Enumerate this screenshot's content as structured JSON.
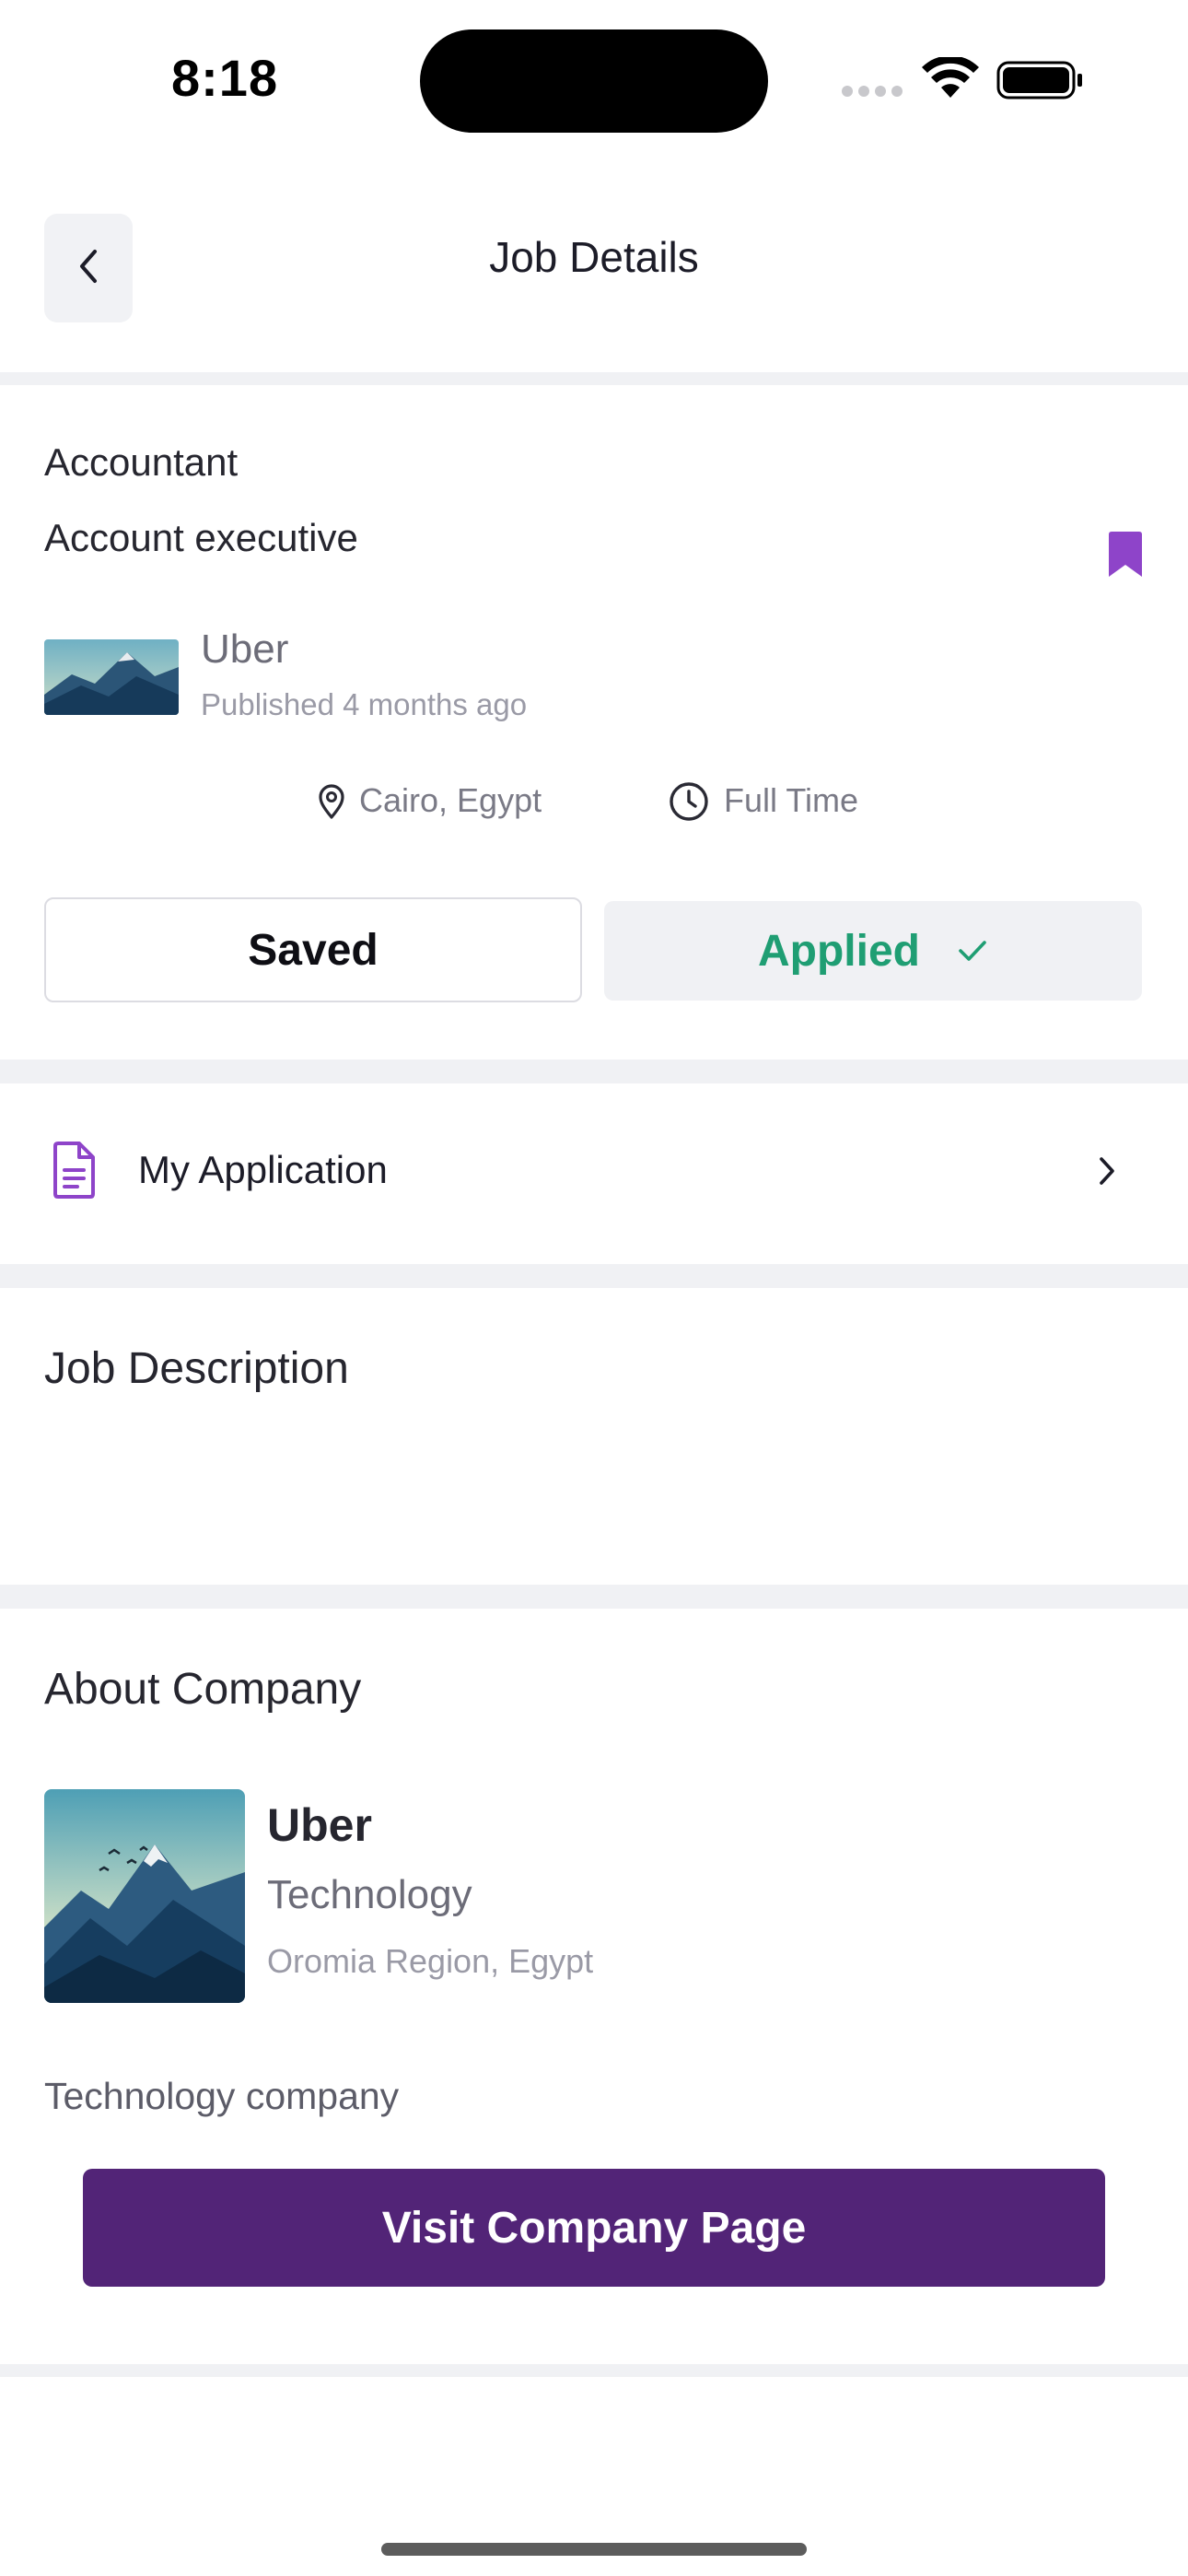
{
  "status_bar": {
    "time": "8:18"
  },
  "header": {
    "title": "Job Details"
  },
  "job": {
    "category": "Accountant",
    "title": "Account executive",
    "company": "Uber",
    "published": "Published 4 months ago",
    "location": "Cairo, Egypt",
    "type": "Full Time"
  },
  "actions": {
    "saved_label": "Saved",
    "applied_label": "Applied"
  },
  "my_application": {
    "label": "My Application"
  },
  "job_description": {
    "heading": "Job Description"
  },
  "about_company": {
    "heading": "About Company",
    "name": "Uber",
    "industry": "Technology",
    "location": "Oromia Region, Egypt",
    "description": "Technology company",
    "visit_label": "Visit Company Page"
  },
  "colors": {
    "accent_purple": "#522477",
    "bookmark_purple": "#8e44c9",
    "applied_green": "#1f9e73",
    "separator": "#f0f1f4"
  },
  "icons": [
    "back-chevron-icon",
    "bookmark-icon",
    "location-pin-icon",
    "clock-icon",
    "check-icon",
    "document-icon",
    "chevron-right-icon",
    "wifi-icon",
    "battery-icon",
    "cellular-icon"
  ]
}
